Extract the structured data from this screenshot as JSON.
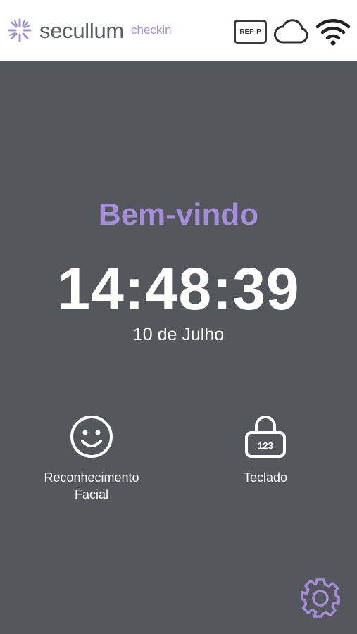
{
  "header": {
    "brand": "secullum",
    "subbrand": "checkin",
    "rep_badge": "REP-P",
    "icons": [
      "secullum-logo-icon",
      "cloud-icon",
      "wifi-icon"
    ]
  },
  "main": {
    "welcome": "Bem-vindo",
    "time": "14:48:39",
    "date": "10 de Julho"
  },
  "options": [
    {
      "label_line1": "Reconhecimento",
      "label_line2": "Facial",
      "icon": "smiley-face-icon"
    },
    {
      "label": "Teclado",
      "icon": "padlock-keypad-icon",
      "keypad_digits": "123"
    }
  ],
  "footer": {
    "icon": "gear-icon"
  },
  "colors": {
    "background": "#54575b",
    "header": "#ffffff",
    "accent": "#a58ddb",
    "text": "#ffffff"
  }
}
